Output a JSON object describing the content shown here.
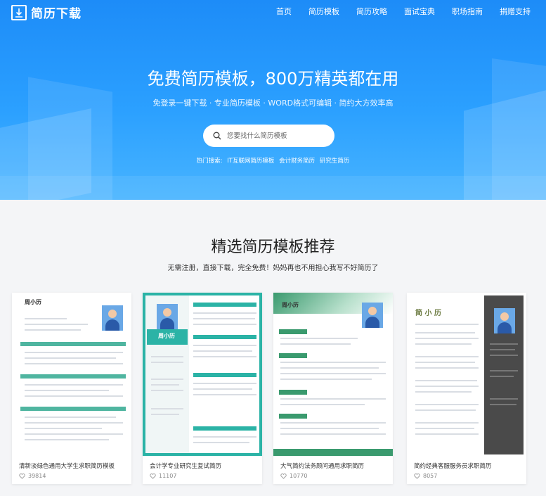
{
  "header": {
    "logo_text": "简历下载",
    "nav": [
      "首页",
      "简历模板",
      "简历攻略",
      "面试宝典",
      "职场指南",
      "捐赠支持"
    ]
  },
  "hero": {
    "title": "免费简历模板，800万精英都在用",
    "subtitle": "免登录一键下载 · 专业简历模板 · WORD格式可编辑 · 简约大方效率高",
    "search_placeholder": "您要找什么简历模板",
    "hot_label": "热门搜索:",
    "hot_links": [
      "IT互联网简历模板",
      "会计财务简历",
      "研究生简历"
    ]
  },
  "section": {
    "title": "精选简历模板推荐",
    "subtitle": "无需注册，直接下载，完全免费！妈妈再也不用担心我写不好简历了"
  },
  "cards": [
    {
      "title": "清新淡绿色通用大学生求职简历模板",
      "likes": "39814",
      "name": "周小历",
      "accent": "#4fb5a0"
    },
    {
      "title": "会计学专业研究生复试简历",
      "likes": "11107",
      "name": "周小历",
      "accent": "#2bb3a6"
    },
    {
      "title": "大气简约法务顾问通用求职简历",
      "likes": "10770",
      "name": "周小历",
      "accent": "#3a9a6e"
    },
    {
      "title": "简约经典客服服务员求职简历",
      "likes": "8057",
      "name": "简 小 历",
      "accent": "#4a4a4a"
    }
  ],
  "icons": {
    "logo": "download-icon",
    "search": "search-icon",
    "like": "heart-icon"
  }
}
